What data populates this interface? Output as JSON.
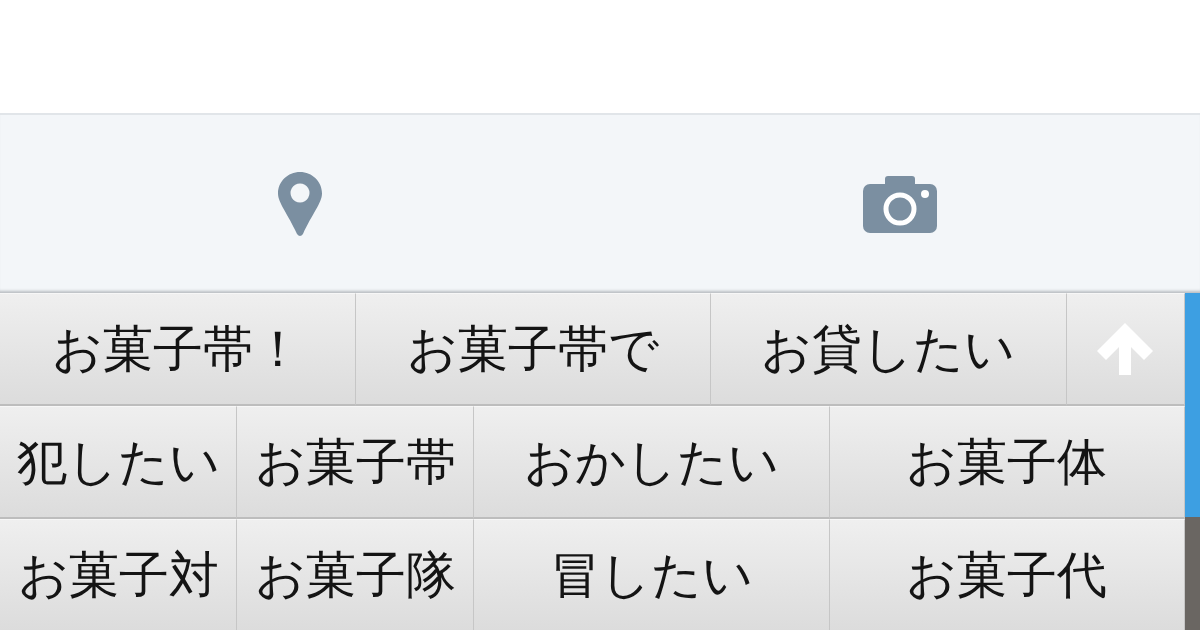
{
  "candidates": {
    "rows": [
      {
        "keys": [
          {
            "kind": "word",
            "text": "お菓子帯！"
          },
          {
            "kind": "word",
            "text": "お菓子帯で"
          },
          {
            "kind": "word",
            "text": "お貸したい"
          },
          {
            "kind": "collapse"
          }
        ]
      },
      {
        "keys": [
          {
            "kind": "word",
            "text": "犯したい"
          },
          {
            "kind": "word",
            "text": "お菓子帯"
          },
          {
            "kind": "word",
            "text": "おかしたい"
          },
          {
            "kind": "word",
            "text": "お菓子体"
          }
        ]
      },
      {
        "keys": [
          {
            "kind": "word",
            "text": "お菓子対"
          },
          {
            "kind": "word",
            "text": "お菓子隊"
          },
          {
            "kind": "word",
            "text": "冒したい"
          },
          {
            "kind": "word",
            "text": "お菓子代"
          }
        ]
      }
    ]
  }
}
